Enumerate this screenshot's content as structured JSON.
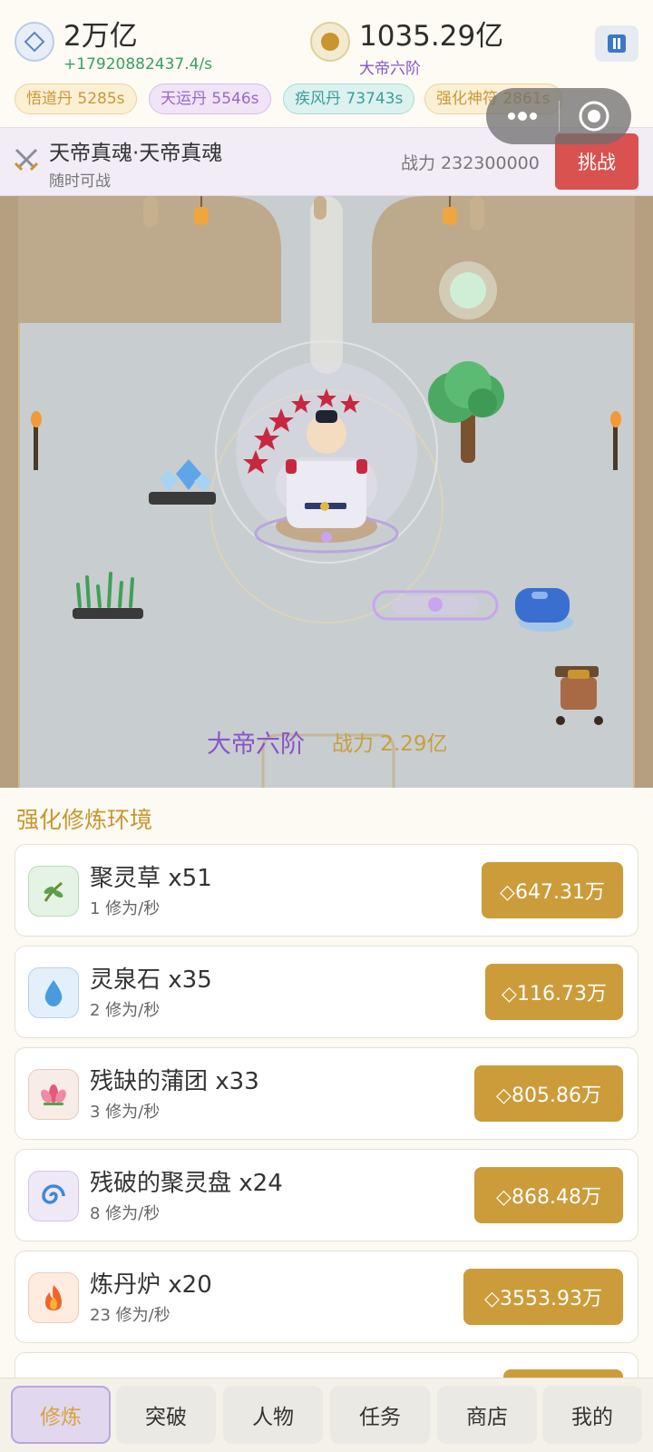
{
  "resources": {
    "spirit_stone": {
      "amount": "2万亿",
      "rate": "+17920882437.4/s",
      "icon": "diamond-icon"
    },
    "gold": {
      "amount": "1035.29亿",
      "realm": "大帝六阶",
      "icon": "coin-icon"
    }
  },
  "buffs": [
    {
      "label": "悟道丹 5285s",
      "color": "#c89a38"
    },
    {
      "label": "天运丹 5546s",
      "color": "#9a68c8"
    },
    {
      "label": "疾风丹 73743s",
      "color": "#3d9c9a"
    },
    {
      "label": "强化神符 2861s",
      "color": "#c89a38"
    }
  ],
  "boss": {
    "name": "天帝真魂·天帝真魂",
    "status": "随时可战",
    "power": "战力 232300000",
    "challenge_label": "挑战"
  },
  "scene": {
    "realm": "大帝六阶",
    "power": "战力 2.29亿"
  },
  "upgrade_panel": {
    "title": "强化修炼环境",
    "items": [
      {
        "name": "聚灵草  x51",
        "rate": "1 修为/秒",
        "price": "◇647.31万",
        "icon": "herb-icon"
      },
      {
        "name": "灵泉石  x35",
        "rate": "2 修为/秒",
        "price": "◇116.73万",
        "icon": "water-drop-icon"
      },
      {
        "name": "残缺的蒲团  x33",
        "rate": "3 修为/秒",
        "price": "◇805.86万",
        "icon": "lotus-icon"
      },
      {
        "name": "残破的聚灵盘  x24",
        "rate": "8 修为/秒",
        "price": "◇868.48万",
        "icon": "swirl-icon"
      },
      {
        "name": "炼丹炉  x20",
        "rate": "23 修为/秒",
        "price": "◇3553.93万",
        "icon": "fire-icon"
      }
    ]
  },
  "nav": {
    "tabs": [
      {
        "label": "修炼",
        "active": true
      },
      {
        "label": "突破"
      },
      {
        "label": "人物"
      },
      {
        "label": "任务"
      },
      {
        "label": "商店"
      },
      {
        "label": "我的"
      }
    ]
  },
  "colors": {
    "accent_gold": "#cc9c3a",
    "challenge_red": "#d9524f",
    "realm_purple": "#8855c8",
    "rate_green": "#3aa05c"
  }
}
